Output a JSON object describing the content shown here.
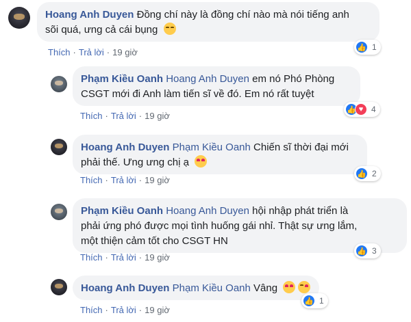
{
  "actions": {
    "like": "Thích",
    "reply": "Trả lời",
    "time": "19 giờ",
    "dot": "·"
  },
  "comments": [
    {
      "author": "Hoang Anh Duyen",
      "mention": "",
      "text": "Đồng chí này là đồng chí nào mà nói tiếng anh",
      "text2": "sõi quá, ưng cả cái bụng",
      "emoji": [
        "grinning-face-emoji"
      ],
      "reactions": {
        "count": "1",
        "types": [
          "like-icon"
        ]
      }
    },
    {
      "author": "Phạm Kiều Oanh",
      "mention": "Hoang Anh Duyen",
      "text": "em nó Phó Phòng",
      "text2": "CSGT mới đi Anh làm tiến sĩ về đó. Em nó rất tuyệt",
      "emoji": [],
      "reactions": {
        "count": "4",
        "types": [
          "like-icon",
          "love-icon"
        ]
      }
    },
    {
      "author": "Hoang Anh Duyen",
      "mention": "Phạm Kiều Oanh",
      "text": "Chiến sĩ thời đại mới",
      "text2": "phải thế. Ưng ưng chị ạ",
      "emoji": [
        "heart-eyes-emoji"
      ],
      "reactions": {
        "count": "2",
        "types": [
          "like-icon"
        ]
      }
    },
    {
      "author": "Phạm Kiều Oanh",
      "mention": "Hoang Anh Duyen",
      "text": "hội nhập phát triển là",
      "text2": "phải ứng phó được mọi tình huống gái nhỉ. Thật sự ưng lắm,",
      "text3": "một thiện cảm tốt cho CSGT HN",
      "emoji": [],
      "reactions": {
        "count": "3",
        "types": [
          "like-icon"
        ]
      }
    },
    {
      "author": "Hoang Anh Duyen",
      "mention": "Phạm Kiều Oanh",
      "text": "Vâng",
      "emoji": [
        "heart-eyes-emoji",
        "smiling-face-hearts-emoji"
      ],
      "reactions": {
        "count": "1",
        "types": [
          "like-icon"
        ]
      }
    }
  ]
}
